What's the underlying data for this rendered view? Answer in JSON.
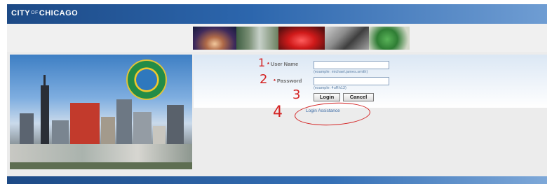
{
  "header": {
    "logo_prefix": "CITY",
    "logo_of": "OF",
    "logo_suffix": "CHICAGO"
  },
  "banner_photos": [
    "cloud-gate-photo",
    "skyline-photo",
    "flowers-photo",
    "sculpture-photo",
    "statue-photo"
  ],
  "login": {
    "username_label": "User Name",
    "username_value": "",
    "username_hint": "(example: michael.james.smith)",
    "password_label": "Password",
    "password_value": "",
    "password_hint": "(example: 4uRh13)",
    "login_button": "Login",
    "cancel_button": "Cancel",
    "assistance_link": "Login Assistance"
  },
  "annotations": {
    "n1": "1",
    "n2": "2",
    "n3": "3",
    "n4": "4"
  },
  "colors": {
    "accent": "#2c66ad",
    "annotation": "#d42323",
    "required": "#cc0000"
  }
}
